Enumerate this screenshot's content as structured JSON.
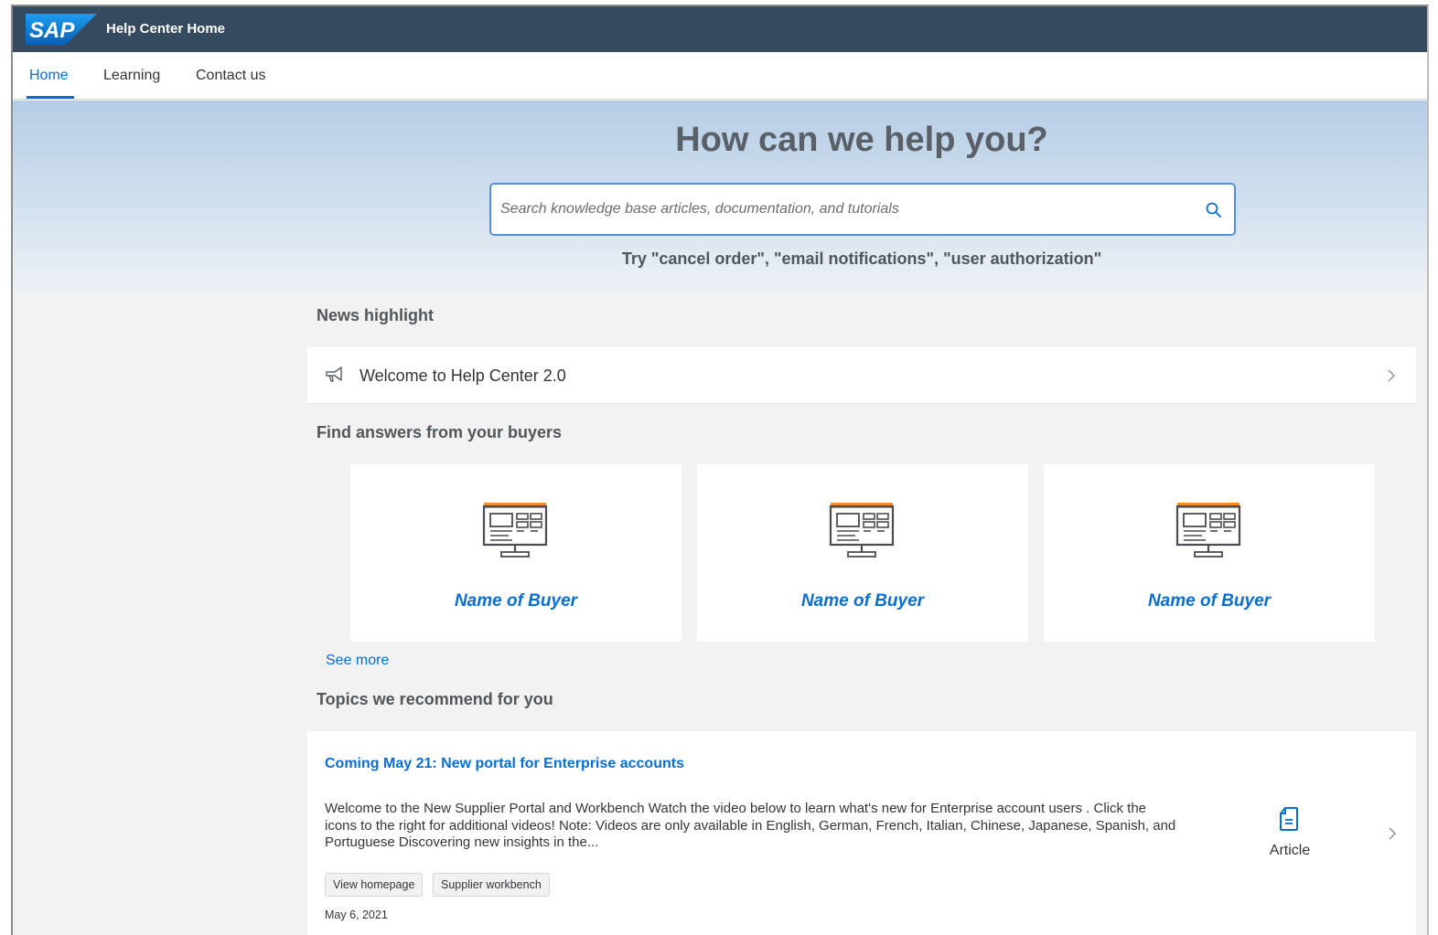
{
  "shell": {
    "logo_text": "SAP",
    "title": "Help Center Home"
  },
  "tabs": [
    {
      "label": "Home",
      "active": true
    },
    {
      "label": "Learning",
      "active": false
    },
    {
      "label": "Contact us",
      "active": false
    }
  ],
  "hero": {
    "title": "How can we help you?",
    "search_placeholder": "Search knowledge base articles, documentation, and tutorials",
    "search_value": "",
    "try_text": "Try  \"cancel order\", \"email notifications\", \"user authorization\""
  },
  "news": {
    "heading": "News highlight",
    "item": {
      "icon": "megaphone-icon",
      "text": "Welcome to Help Center 2.0"
    }
  },
  "buyers": {
    "heading": "Find answers from your buyers",
    "cards": [
      {
        "name": "Name of Buyer",
        "icon": "monitor-icon"
      },
      {
        "name": "Name of Buyer",
        "icon": "monitor-icon"
      },
      {
        "name": "Name of Buyer",
        "icon": "monitor-icon"
      }
    ],
    "see_more": "See more"
  },
  "topics": {
    "heading": "Topics we recommend for you",
    "items": [
      {
        "title": "Coming May 21: New portal for Enterprise accounts",
        "body": "Welcome to the New Supplier Portal and Workbench Watch the video below to learn what's new for Enterprise account users . Click the icons to the right for additional videos! Note: Videos are only available in English, German, French, Italian, Chinese, Japanese, Spanish, and Portuguese Discovering new insights in the...",
        "tags": [
          "View homepage",
          "Supplier workbench"
        ],
        "date": "May 6, 2021",
        "type_icon": "article-icon",
        "type_label": "Article"
      }
    ]
  },
  "colors": {
    "shell_bg": "#354a5f",
    "accent": "#0a6ed1",
    "monitor_bar": "#f0912a"
  }
}
